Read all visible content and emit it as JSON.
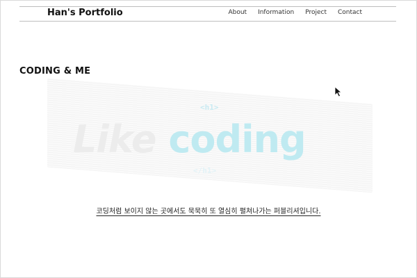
{
  "header": {
    "brand": "Han's Portfolio",
    "nav": [
      "About",
      "Information",
      "Project",
      "Contact"
    ]
  },
  "section": {
    "title": "CODING & ME"
  },
  "banner": {
    "tag_open": "<h1>",
    "tag_close": "</h1>",
    "word1": "Like",
    "word2": "coding"
  },
  "tagline": "코딩처럼 보이지 않는 곳에서도 묵묵히 또 열심히 펼쳐나가는 퍼블리셔입니다.",
  "colors": {
    "accent": "#bfeaf1",
    "text": "#111111",
    "faded": "#ececec"
  }
}
